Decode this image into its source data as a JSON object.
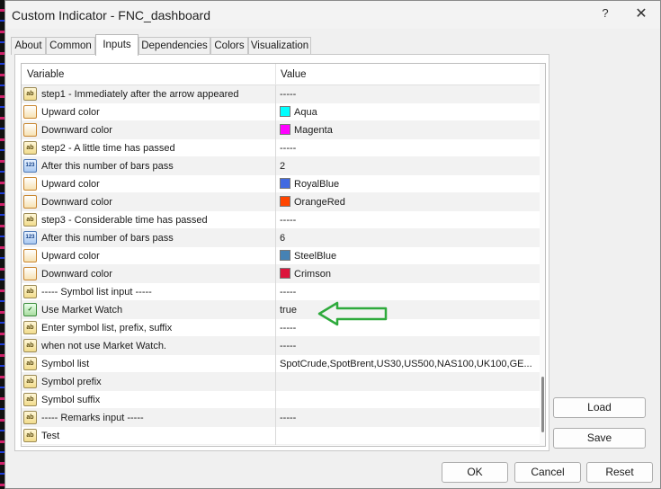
{
  "window": {
    "title": "Custom Indicator - FNC_dashboard",
    "help_glyph": "?",
    "close_glyph": "✕"
  },
  "tabs": [
    {
      "label": "About"
    },
    {
      "label": "Common"
    },
    {
      "label": "Inputs"
    },
    {
      "label": "Dependencies"
    },
    {
      "label": "Colors"
    },
    {
      "label": "Visualization"
    }
  ],
  "table": {
    "columns": {
      "variable": "Variable",
      "value": "Value"
    },
    "rows": [
      {
        "icon": "ab",
        "name": "step1 - Immediately after the arrow appeared",
        "value": "-----"
      },
      {
        "icon": "color",
        "name": "Upward color",
        "value": "Aqua",
        "swatch": "#00ffff"
      },
      {
        "icon": "color",
        "name": "Downward color",
        "value": "Magenta",
        "swatch": "#ff00ff"
      },
      {
        "icon": "ab",
        "name": "step2 - A little time has passed",
        "value": "-----"
      },
      {
        "icon": "123",
        "name": "After this number of bars pass",
        "value": "2"
      },
      {
        "icon": "color",
        "name": "Upward color",
        "value": "RoyalBlue",
        "swatch": "#4169e1"
      },
      {
        "icon": "color",
        "name": "Downward color",
        "value": "OrangeRed",
        "swatch": "#ff4500"
      },
      {
        "icon": "ab",
        "name": "step3 - Considerable time has passed",
        "value": "-----"
      },
      {
        "icon": "123",
        "name": "After this number of bars pass",
        "value": "6"
      },
      {
        "icon": "color",
        "name": "Upward color",
        "value": "SteelBlue",
        "swatch": "#4682b4"
      },
      {
        "icon": "color",
        "name": "Downward color",
        "value": "Crimson",
        "swatch": "#dc143c"
      },
      {
        "icon": "ab",
        "name": "----- Symbol list input -----",
        "value": "-----"
      },
      {
        "icon": "bool",
        "name": "Use Market Watch",
        "value": "true"
      },
      {
        "icon": "ab",
        "name": "Enter symbol list, prefix, suffix",
        "value": "-----"
      },
      {
        "icon": "ab",
        "name": "when not use Market Watch.",
        "value": "-----"
      },
      {
        "icon": "ab",
        "name": "Symbol list",
        "value": "SpotCrude,SpotBrent,US30,US500,NAS100,UK100,GE..."
      },
      {
        "icon": "ab",
        "name": "Symbol prefix",
        "value": ""
      },
      {
        "icon": "ab",
        "name": "Symbol suffix",
        "value": ""
      },
      {
        "icon": "ab",
        "name": "----- Remarks input -----",
        "value": "-----"
      },
      {
        "icon": "ab",
        "name": "Test",
        "value": ""
      }
    ]
  },
  "buttons": {
    "load": "Load",
    "save": "Save",
    "ok": "OK",
    "cancel": "Cancel",
    "reset": "Reset"
  },
  "annotation": {
    "color": "#2eaa3c",
    "icon": "left-arrow-icon"
  }
}
